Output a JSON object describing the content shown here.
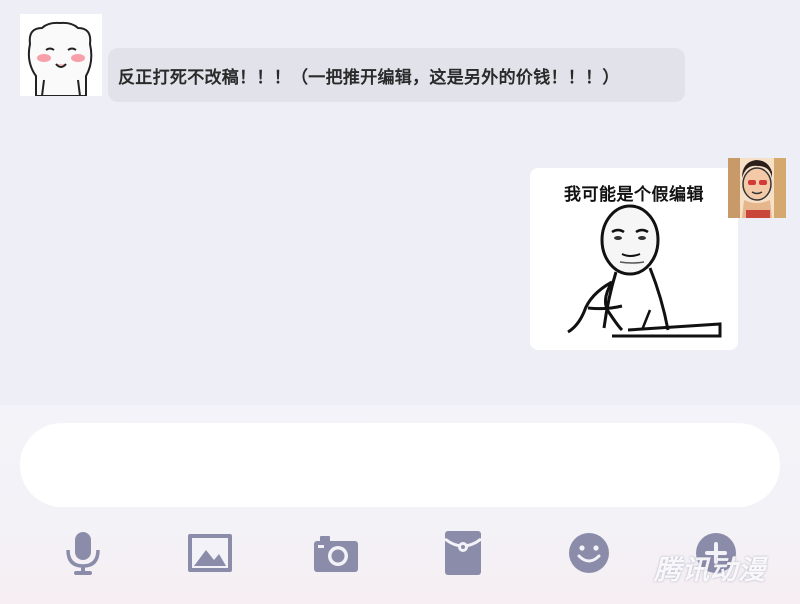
{
  "conversation": {
    "incoming_message": "反正打死不改稿！！！（一把推开编辑，这是另外的价钱！！！）",
    "outgoing_sticker_caption": "我可能是个假编辑"
  },
  "composer": {
    "input_value": "",
    "input_placeholder": "",
    "toolbar": [
      {
        "icon": "microphone-icon"
      },
      {
        "icon": "image-icon"
      },
      {
        "icon": "camera-icon"
      },
      {
        "icon": "red-packet-icon"
      },
      {
        "icon": "emoji-icon"
      },
      {
        "icon": "plus-icon"
      }
    ]
  },
  "watermark": "腾讯动漫",
  "colors": {
    "background": "#edeef6",
    "bubble_incoming": "#e2e3ea",
    "bubble_outgoing": "#ffffff",
    "toolbar_icon": "#8b8ca9"
  }
}
